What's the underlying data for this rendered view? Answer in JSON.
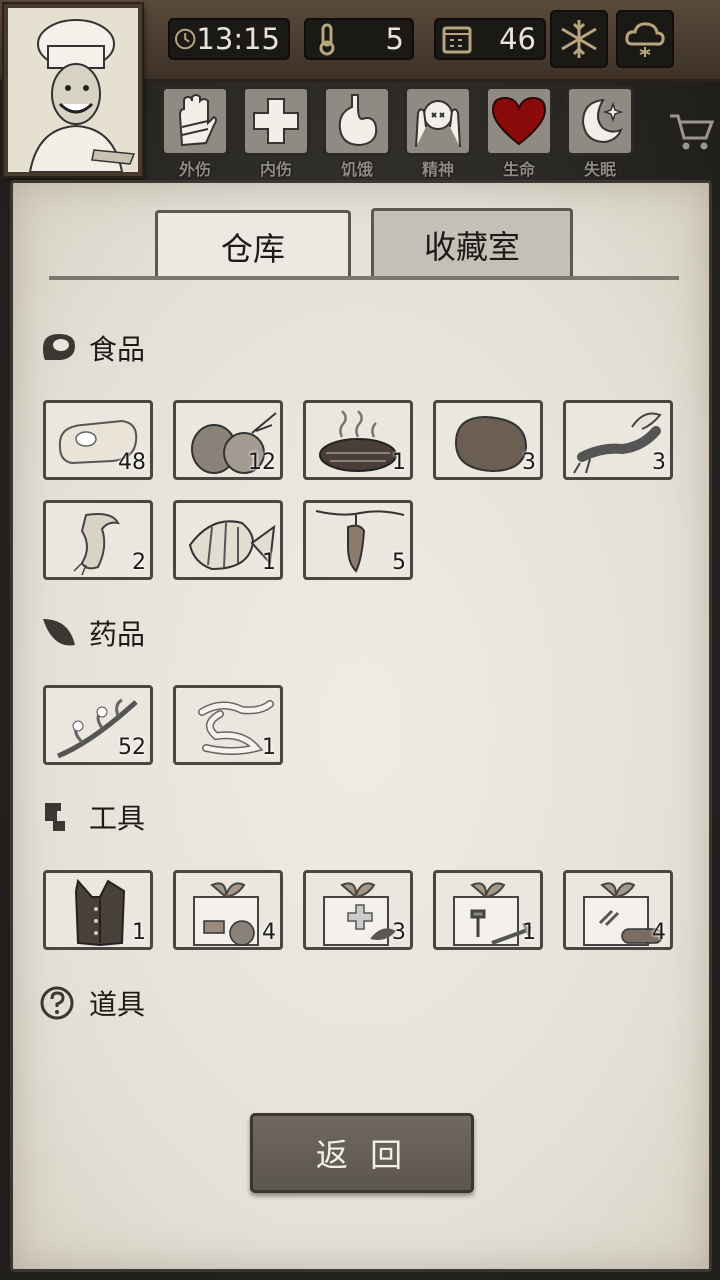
{
  "top": {
    "time": "13:15",
    "temperature": "5",
    "day": "46"
  },
  "status": [
    {
      "label": "外伤"
    },
    {
      "label": "内伤"
    },
    {
      "label": "饥饿"
    },
    {
      "label": "精神"
    },
    {
      "label": "生命"
    },
    {
      "label": "失眠"
    }
  ],
  "tabs": {
    "warehouse": "仓库",
    "collection": "收藏室"
  },
  "sections": {
    "food": "食品",
    "medicine": "药品",
    "tools": "工具",
    "props": "道具"
  },
  "food_items": [
    {
      "icon": "raw-meat-icon",
      "qty": "48"
    },
    {
      "icon": "onion-icon",
      "qty": "12"
    },
    {
      "icon": "cooked-meat-icon",
      "qty": "1"
    },
    {
      "icon": "potato-icon",
      "qty": "3"
    },
    {
      "icon": "lobster-icon",
      "qty": "3"
    },
    {
      "icon": "catfish-icon",
      "qty": "2"
    },
    {
      "icon": "angelfish-icon",
      "qty": "1"
    },
    {
      "icon": "hanging-meat-icon",
      "qty": "5"
    }
  ],
  "medicine_items": [
    {
      "icon": "herb-branch-icon",
      "qty": "52"
    },
    {
      "icon": "bandage-icon",
      "qty": "1"
    }
  ],
  "tool_items": [
    {
      "icon": "vest-icon",
      "qty": "1"
    },
    {
      "icon": "food-gift-box-icon",
      "qty": "4"
    },
    {
      "icon": "medical-gift-box-icon",
      "qty": "3"
    },
    {
      "icon": "tool-gift-box-icon",
      "qty": "1"
    },
    {
      "icon": "material-gift-box-icon",
      "qty": "4"
    }
  ],
  "buttons": {
    "return": "返 回"
  },
  "colors": {
    "life_heart": "#8b0a0a",
    "paper": "#ebe7df",
    "frame": "#4b4641"
  }
}
